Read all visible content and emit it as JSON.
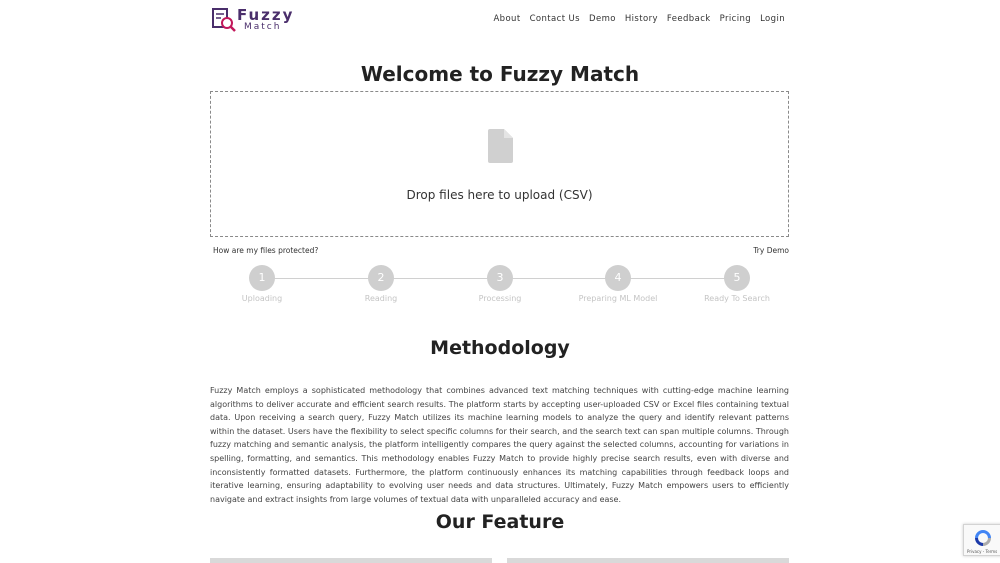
{
  "header": {
    "logo": {
      "top": "Fuzzy",
      "bottom": "Match"
    },
    "nav": [
      "About",
      "Contact Us",
      "Demo",
      "History",
      "Feedback",
      "Pricing",
      "Login"
    ]
  },
  "page_title": "Welcome to Fuzzy Match",
  "upload": {
    "drop_text": "Drop files here to upload (CSV)",
    "protect_link": "How are my files protected?",
    "try_demo": "Try Demo"
  },
  "steps": [
    {
      "number": "1",
      "label": "Uploading"
    },
    {
      "number": "2",
      "label": "Reading"
    },
    {
      "number": "3",
      "label": "Processing"
    },
    {
      "number": "4",
      "label": "Preparing ML Model"
    },
    {
      "number": "5",
      "label": "Ready To Search"
    }
  ],
  "methodology": {
    "title": "Methodology",
    "text": "Fuzzy Match employs a sophisticated methodology that combines advanced text matching techniques with cutting-edge machine learning algorithms to deliver accurate and efficient search results. The platform starts by accepting user-uploaded CSV or Excel files containing textual data. Upon receiving a search query, Fuzzy Match utilizes its machine learning models to analyze the query and identify relevant patterns within the dataset. Users have the flexibility to select specific columns for their search, and the search text can span multiple columns. Through fuzzy matching and semantic analysis, the platform intelligently compares the query against the selected columns, accounting for variations in spelling, formatting, and semantics. This methodology enables Fuzzy Match to provide highly precise search results, even with diverse and inconsistently formatted datasets. Furthermore, the platform continuously enhances its matching capabilities through feedback loops and iterative learning, ensuring adaptability to evolving user needs and data structures. Ultimately, Fuzzy Match empowers users to efficiently navigate and extract insights from large volumes of textual data with unparalleled accuracy and ease."
  },
  "features": {
    "title": "Our Feature"
  },
  "recaptcha": {
    "text": "Privacy - Terms"
  },
  "colors": {
    "brand": "#4a2e6b",
    "step": "#cfcfcf"
  }
}
